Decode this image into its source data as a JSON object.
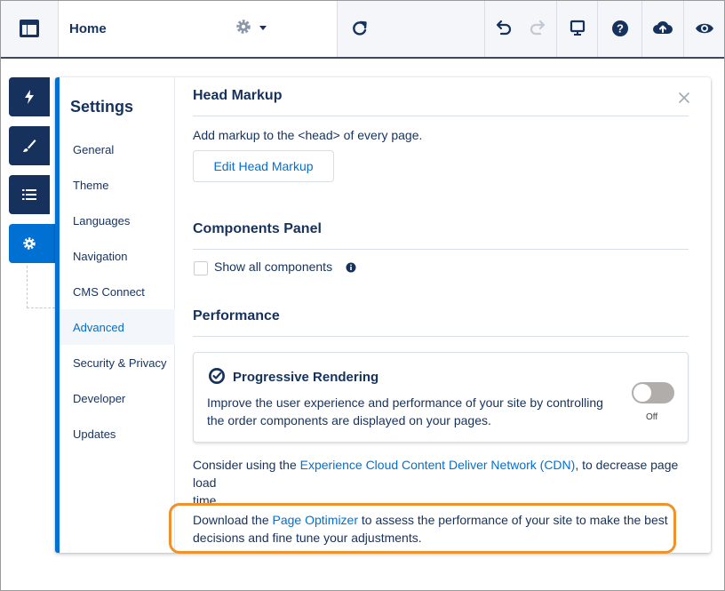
{
  "topbar": {
    "page_name": "Home",
    "icons": {
      "logo": "layout-icon",
      "page_settings": "gear-icon",
      "dropdown": "chevron-down-icon",
      "refresh": "refresh-icon",
      "undo": "undo-icon",
      "redo": "redo-icon",
      "device": "desktop-icon",
      "help": "help-icon",
      "publish": "cloud-upload-icon",
      "preview": "eye-icon"
    }
  },
  "rail": {
    "items": [
      {
        "name": "lightning-icon"
      },
      {
        "name": "brush-icon"
      },
      {
        "name": "list-icon"
      },
      {
        "name": "settings-gear-icon"
      }
    ]
  },
  "settings": {
    "title": "Settings",
    "nav": [
      {
        "label": "General"
      },
      {
        "label": "Theme"
      },
      {
        "label": "Languages"
      },
      {
        "label": "Navigation"
      },
      {
        "label": "CMS Connect"
      },
      {
        "label": "Advanced"
      },
      {
        "label": "Security & Privacy"
      },
      {
        "label": "Developer"
      },
      {
        "label": "Updates"
      }
    ],
    "active_item": "Advanced"
  },
  "head_markup": {
    "title": "Head Markup",
    "description": "Add markup to the <head> of every page.",
    "button_label": "Edit Head Markup"
  },
  "components_panel": {
    "title": "Components Panel",
    "checkbox_label": "Show all components",
    "checked": false
  },
  "performance": {
    "title": "Performance",
    "progressive_rendering": {
      "title": "Progressive Rendering",
      "description_line1": "Improve the user experience and performance of your site by controlling",
      "description_line2": "the order components are displayed on your pages.",
      "toggle_label": "Off",
      "enabled": false
    },
    "cdn": {
      "prefix": "Consider using the ",
      "link": "Experience Cloud Content Deliver Network (CDN)",
      "suffix_line1": ", to decrease page load",
      "line2": "time."
    },
    "optimizer": {
      "prefix": "Download the ",
      "link": "Page Optimizer",
      "suffix_line1": " to assess the performance of your site to make the best",
      "line2": "decisions and fine tune your adjustments."
    }
  },
  "colors": {
    "brand_blue": "#0070d2",
    "navy": "#16325c",
    "highlight": "#f0922b"
  }
}
